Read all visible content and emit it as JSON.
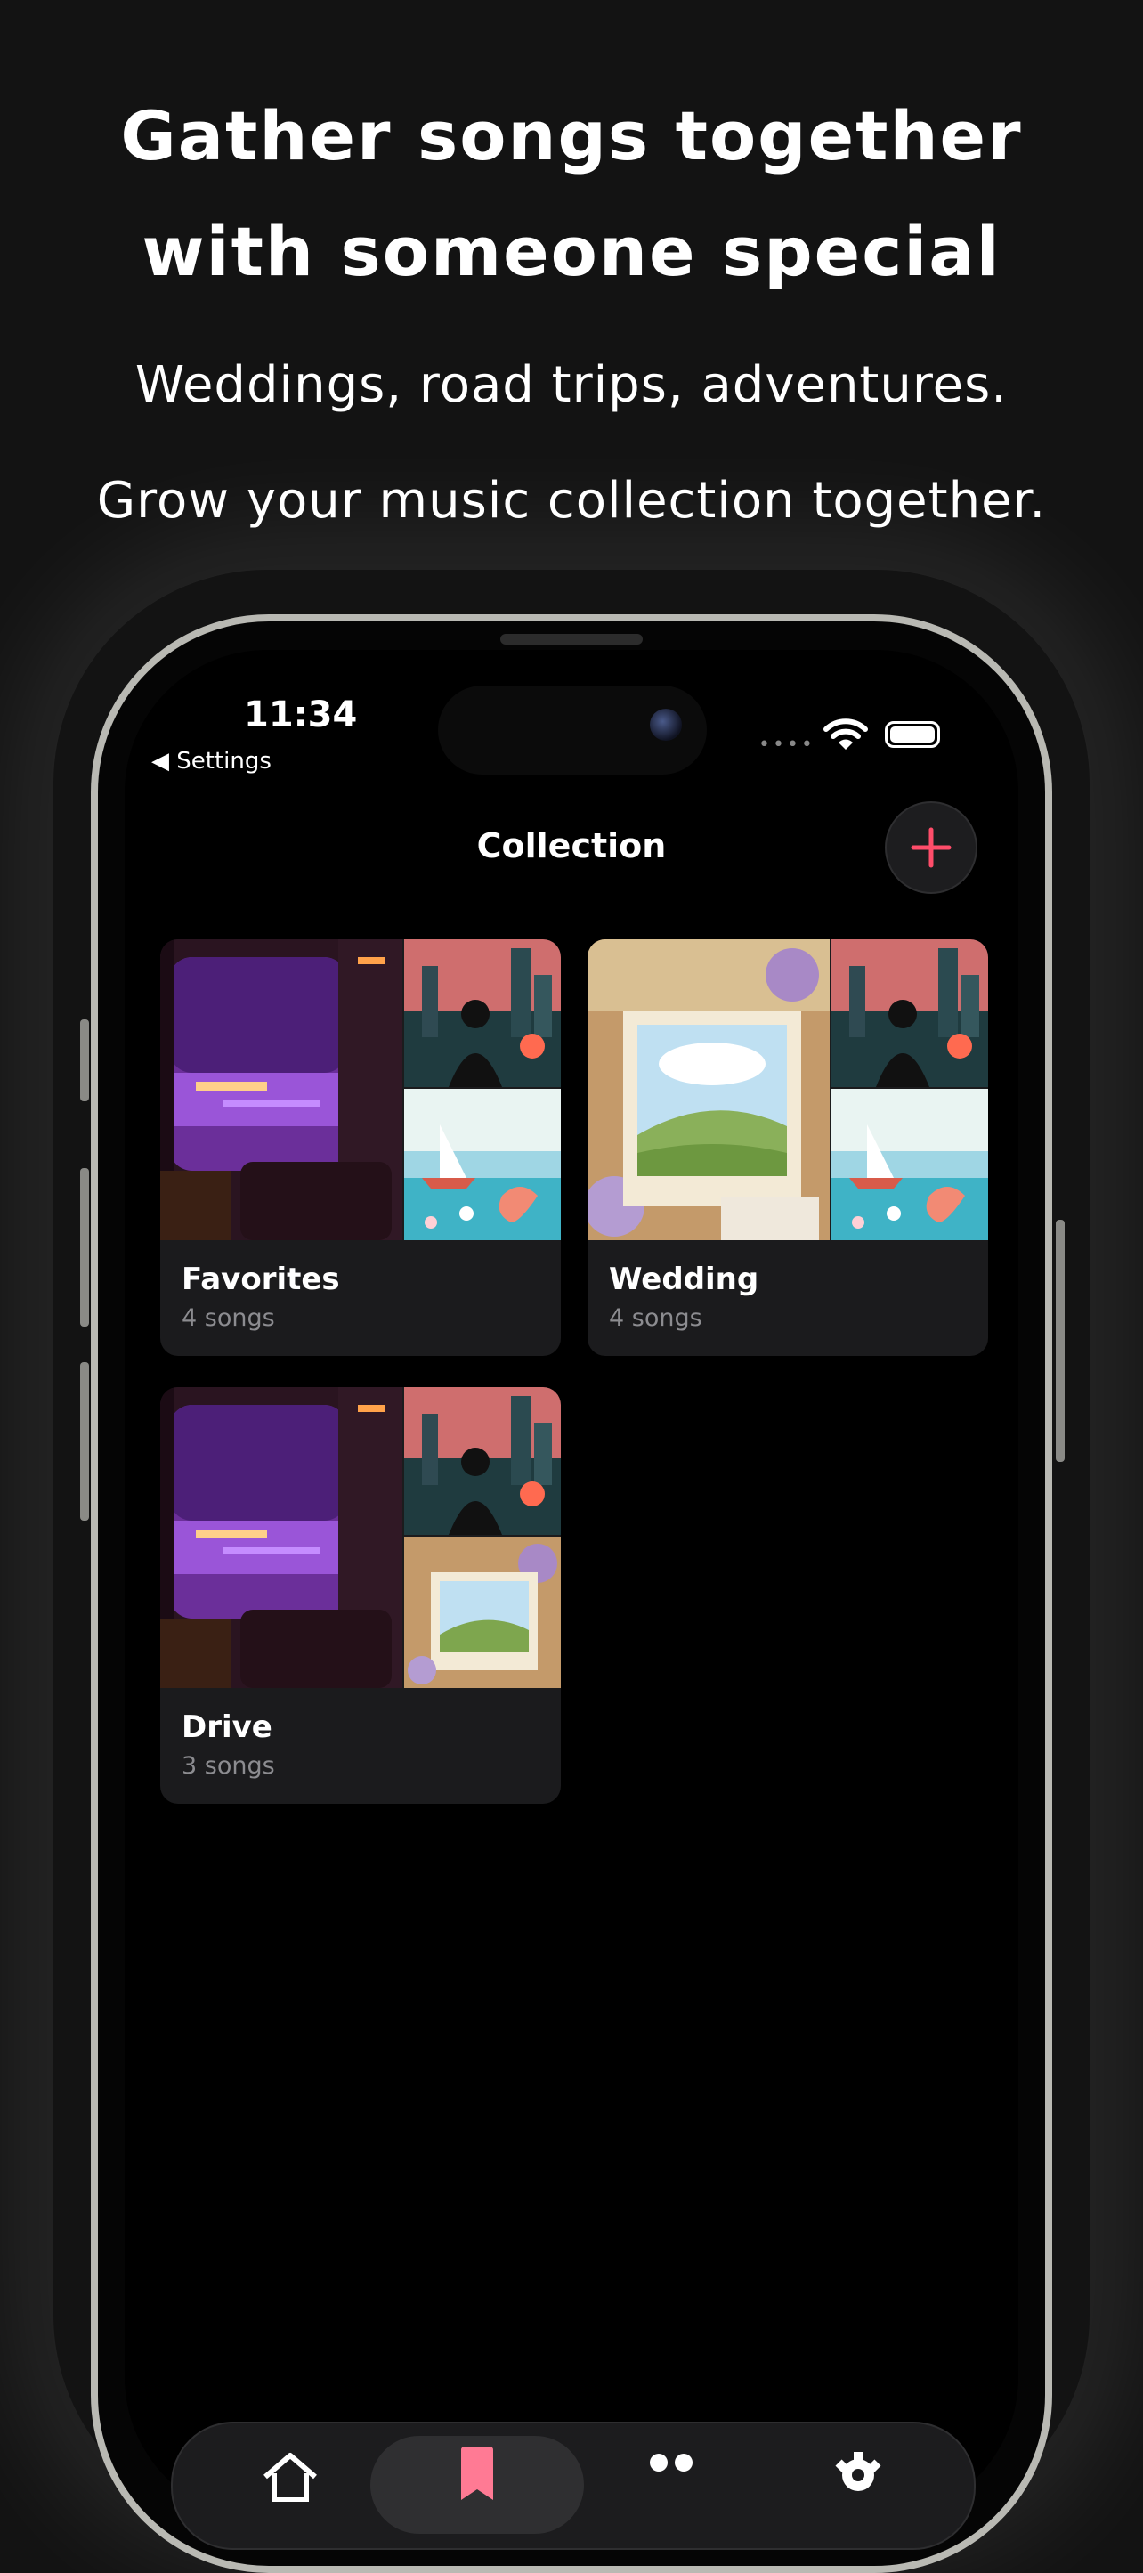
{
  "promo": {
    "headline_line1": "Gather songs together",
    "headline_line2": "with someone special",
    "subline1": "Weddings, road trips, adventures.",
    "subline2": "Grow your music collection together."
  },
  "status_bar": {
    "time": "11:34",
    "back_label": "◀ Settings",
    "signal_dots": "••••"
  },
  "nav": {
    "title": "Collection",
    "add_icon": "plus-icon",
    "accent_color": "#ff4d6a"
  },
  "collections": [
    {
      "title": "Favorites",
      "count": "4 songs"
    },
    {
      "title": "Wedding",
      "count": "4 songs"
    },
    {
      "title": "Drive",
      "count": "3 songs"
    }
  ],
  "tabbar": {
    "tabs": [
      {
        "icon": "home-icon"
      },
      {
        "icon": "bookmark-icon",
        "active": true
      },
      {
        "icon": "people-icon"
      },
      {
        "icon": "gear-icon"
      }
    ]
  }
}
